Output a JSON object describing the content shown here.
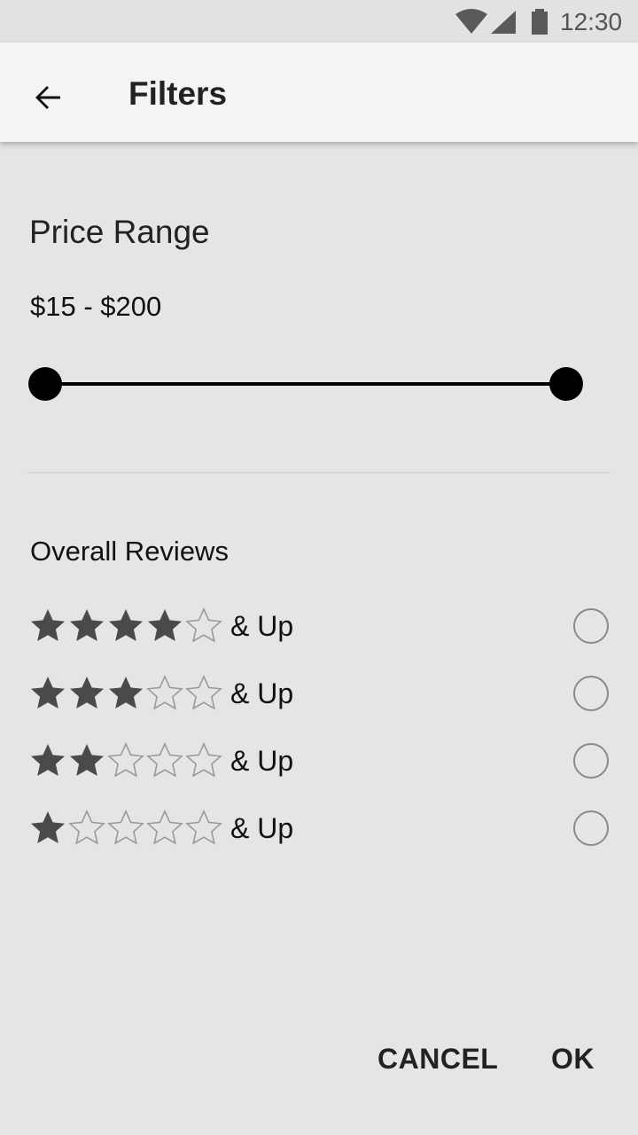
{
  "status_bar": {
    "time": "12:30",
    "icons": [
      "wifi-icon",
      "cellular-signal-icon",
      "battery-icon"
    ]
  },
  "app_bar": {
    "back_icon": "arrow-back-icon",
    "title": "Filters"
  },
  "price": {
    "section_title": "Price Range",
    "range_label": "$15 - $200",
    "slider": {
      "min_value": 15,
      "max_value": 200,
      "thumb_min_fraction": 0,
      "thumb_max_fraction": 1
    }
  },
  "reviews": {
    "section_title": "Overall Reviews",
    "options": [
      {
        "filled_stars": 4,
        "total_stars": 5,
        "label": "& Up",
        "selected": false
      },
      {
        "filled_stars": 3,
        "total_stars": 5,
        "label": "& Up",
        "selected": false
      },
      {
        "filled_stars": 2,
        "total_stars": 5,
        "label": "& Up",
        "selected": false
      },
      {
        "filled_stars": 1,
        "total_stars": 5,
        "label": "& Up",
        "selected": false
      }
    ]
  },
  "actions": {
    "cancel_label": "CANCEL",
    "ok_label": "OK"
  },
  "colors": {
    "background": "#e5e5e5",
    "app_bar": "#f4f4f4",
    "star_filled": "#4a4a4a",
    "star_empty_outline": "#9a9a9a",
    "slider": "#000000"
  }
}
